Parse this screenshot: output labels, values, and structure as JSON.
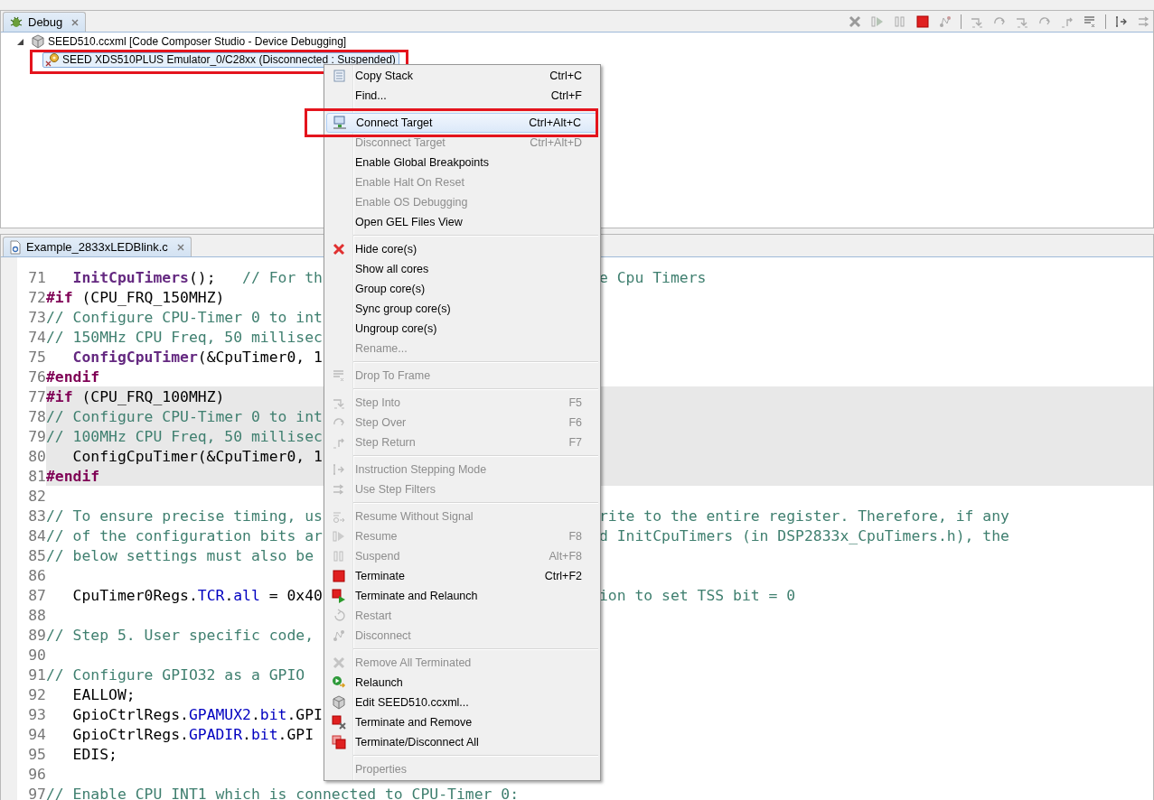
{
  "debug_view": {
    "tab": {
      "label": "Debug",
      "selected": true
    },
    "tree": [
      {
        "label": "SEED510.ccxml [Code Composer Studio - Device Debugging]",
        "expanded": true,
        "selected": false,
        "annotated": false,
        "children": [
          {
            "label": "SEED XDS510PLUS Emulator_0/C28xx (Disconnected : Suspended)",
            "selected": true,
            "annotated": true
          }
        ]
      }
    ]
  },
  "editor": {
    "tab": {
      "label": "Example_2833xLEDBlink.c",
      "selected": true
    },
    "lines": [
      {
        "number": "71",
        "highlighted": false,
        "parts": [
          {
            "kind": "function",
            "text": "   InitCpuTimers"
          },
          {
            "kind": "text",
            "text": "();   "
          },
          {
            "kind": "comment",
            "text": "// For th"
          }
        ],
        "right": [
          {
            "kind": "comment",
            "text": "e Cpu Timers"
          }
        ]
      },
      {
        "number": "72",
        "highlighted": false,
        "parts": [
          {
            "kind": "directive",
            "text": "#if"
          },
          {
            "kind": "text",
            "text": " (CPU_FRQ_150MHZ)"
          }
        ]
      },
      {
        "number": "73",
        "highlighted": false,
        "parts": [
          {
            "kind": "comment",
            "text": "// Configure CPU-Timer 0 to int"
          }
        ]
      },
      {
        "number": "74",
        "highlighted": false,
        "parts": [
          {
            "kind": "comment",
            "text": "// 150MHz CPU Freq, 50 millisec"
          }
        ]
      },
      {
        "number": "75",
        "highlighted": false,
        "parts": [
          {
            "kind": "function",
            "text": "   ConfigCpuTimer"
          },
          {
            "kind": "text",
            "text": "(&CpuTimer0, 1"
          }
        ]
      },
      {
        "number": "76",
        "highlighted": false,
        "parts": [
          {
            "kind": "directive",
            "text": "#endif"
          }
        ]
      },
      {
        "number": "77",
        "highlighted": true,
        "parts": [
          {
            "kind": "directive",
            "text": "#if"
          },
          {
            "kind": "text",
            "text": " (CPU_FRQ_100MHZ)"
          }
        ]
      },
      {
        "number": "78",
        "highlighted": true,
        "parts": [
          {
            "kind": "comment",
            "text": "// Configure CPU-Timer 0 to int"
          }
        ]
      },
      {
        "number": "79",
        "highlighted": true,
        "parts": [
          {
            "kind": "comment",
            "text": "// 100MHz CPU Freq, 50 millisec"
          }
        ]
      },
      {
        "number": "80",
        "highlighted": true,
        "parts": [
          {
            "kind": "text",
            "text": "   ConfigCpuTimer(&CpuTimer0, 1"
          }
        ]
      },
      {
        "number": "81",
        "highlighted": true,
        "parts": [
          {
            "kind": "directive",
            "text": "#endif"
          }
        ]
      },
      {
        "number": "82",
        "highlighted": false
      },
      {
        "number": "83",
        "highlighted": false,
        "parts": [
          {
            "kind": "comment",
            "text": "// To ensure precise timing, us"
          }
        ],
        "right": [
          {
            "kind": "comment",
            "text": "rite to the entire register. Therefore, if any"
          }
        ]
      },
      {
        "number": "84",
        "highlighted": false,
        "parts": [
          {
            "kind": "comment",
            "text": "// of the configuration bits ar"
          }
        ],
        "right": [
          {
            "kind": "comment",
            "text": "d InitCpuTimers (in DSP2833x_CpuTimers.h), the"
          }
        ]
      },
      {
        "number": "85",
        "highlighted": false,
        "parts": [
          {
            "kind": "comment",
            "text": "// below settings must also be"
          }
        ]
      },
      {
        "number": "86",
        "highlighted": false
      },
      {
        "number": "87",
        "highlighted": false,
        "parts": [
          {
            "kind": "text",
            "text": "   CpuTimer0Regs."
          },
          {
            "kind": "field",
            "text": "TCR"
          },
          {
            "kind": "text",
            "text": "."
          },
          {
            "kind": "field",
            "text": "all"
          },
          {
            "kind": "text",
            "text": " = 0x40"
          }
        ],
        "right": [
          {
            "kind": "comment",
            "text": "ion to set TSS bit = 0"
          }
        ]
      },
      {
        "number": "88",
        "highlighted": false
      },
      {
        "number": "89",
        "highlighted": false,
        "parts": [
          {
            "kind": "comment",
            "text": "// Step 5. User specific code,"
          }
        ]
      },
      {
        "number": "90",
        "highlighted": false
      },
      {
        "number": "91",
        "highlighted": false,
        "parts": [
          {
            "kind": "comment",
            "text": "// Configure GPIO32 as a GPIO"
          }
        ]
      },
      {
        "number": "92",
        "highlighted": false,
        "parts": [
          {
            "kind": "text",
            "text": "   EALLOW;"
          }
        ]
      },
      {
        "number": "93",
        "highlighted": false,
        "parts": [
          {
            "kind": "text",
            "text": "   GpioCtrlRegs."
          },
          {
            "kind": "field",
            "text": "GPAMUX2"
          },
          {
            "kind": "text",
            "text": "."
          },
          {
            "kind": "field",
            "text": "bit"
          },
          {
            "kind": "text",
            "text": ".GPI"
          }
        ]
      },
      {
        "number": "94",
        "highlighted": false,
        "parts": [
          {
            "kind": "text",
            "text": "   GpioCtrlRegs."
          },
          {
            "kind": "field",
            "text": "GPADIR"
          },
          {
            "kind": "text",
            "text": "."
          },
          {
            "kind": "field",
            "text": "bit"
          },
          {
            "kind": "text",
            "text": ".GPI"
          }
        ]
      },
      {
        "number": "95",
        "highlighted": false,
        "parts": [
          {
            "kind": "text",
            "text": "   EDIS;"
          }
        ]
      },
      {
        "number": "96",
        "highlighted": false
      },
      {
        "number": "97",
        "highlighted": false,
        "parts": [
          {
            "kind": "comment",
            "text": "// Enable CPU INT1 which is connected to CPU-Timer 0:"
          }
        ]
      }
    ]
  },
  "context_menu": {
    "groups": [
      [
        {
          "label": "Copy Stack",
          "shortcut": "Ctrl+C",
          "disabled": false,
          "selected": false,
          "annotated": false
        },
        {
          "label": "Find...",
          "shortcut": "Ctrl+F",
          "disabled": false,
          "selected": false,
          "annotated": false
        }
      ],
      [
        {
          "label": "Connect Target",
          "shortcut": "Ctrl+Alt+C",
          "disabled": false,
          "selected": true,
          "annotated": true
        },
        {
          "label": "Disconnect Target",
          "shortcut": "Ctrl+Alt+D",
          "disabled": true,
          "selected": false,
          "annotated": false
        },
        {
          "label": "Enable Global Breakpoints",
          "disabled": false,
          "selected": false,
          "annotated": false
        },
        {
          "label": "Enable Halt On Reset",
          "disabled": true,
          "selected": false,
          "annotated": false
        },
        {
          "label": "Enable OS Debugging",
          "disabled": true,
          "selected": false,
          "annotated": false
        },
        {
          "label": "Open GEL Files View",
          "disabled": false,
          "selected": false,
          "annotated": false
        }
      ],
      [
        {
          "label": "Hide core(s)",
          "disabled": false,
          "selected": false,
          "annotated": false
        },
        {
          "label": "Show all cores",
          "disabled": false,
          "selected": false,
          "annotated": false
        },
        {
          "label": "Group core(s)",
          "disabled": false,
          "selected": false,
          "annotated": false
        },
        {
          "label": "Sync group core(s)",
          "disabled": false,
          "selected": false,
          "annotated": false
        },
        {
          "label": "Ungroup core(s)",
          "disabled": false,
          "selected": false,
          "annotated": false
        },
        {
          "label": "Rename...",
          "disabled": true,
          "selected": false,
          "annotated": false
        }
      ],
      [
        {
          "label": "Drop To Frame",
          "disabled": true,
          "selected": false,
          "annotated": false
        }
      ],
      [
        {
          "label": "Step Into",
          "shortcut": "F5",
          "disabled": true,
          "selected": false,
          "annotated": false
        },
        {
          "label": "Step Over",
          "shortcut": "F6",
          "disabled": true,
          "selected": false,
          "annotated": false
        },
        {
          "label": "Step Return",
          "shortcut": "F7",
          "disabled": true,
          "selected": false,
          "annotated": false
        }
      ],
      [
        {
          "label": "Instruction Stepping Mode",
          "disabled": true,
          "selected": false,
          "annotated": false
        },
        {
          "label": "Use Step Filters",
          "disabled": true,
          "selected": false,
          "annotated": false
        }
      ],
      [
        {
          "label": "Resume Without Signal",
          "disabled": true,
          "selected": false,
          "annotated": false
        },
        {
          "label": "Resume",
          "shortcut": "F8",
          "disabled": true,
          "selected": false,
          "annotated": false
        },
        {
          "label": "Suspend",
          "shortcut": "Alt+F8",
          "disabled": true,
          "selected": false,
          "annotated": false
        },
        {
          "label": "Terminate",
          "shortcut": "Ctrl+F2",
          "disabled": false,
          "selected": false,
          "annotated": false
        },
        {
          "label": "Terminate and Relaunch",
          "disabled": false,
          "selected": false,
          "annotated": false
        },
        {
          "label": "Restart",
          "disabled": true,
          "selected": false,
          "annotated": false
        },
        {
          "label": "Disconnect",
          "disabled": true,
          "selected": false,
          "annotated": false
        }
      ],
      [
        {
          "label": "Remove All Terminated",
          "disabled": true,
          "selected": false,
          "annotated": false
        },
        {
          "label": "Relaunch",
          "disabled": false,
          "selected": false,
          "annotated": false
        },
        {
          "label": "Edit SEED510.ccxml...",
          "disabled": false,
          "selected": false,
          "annotated": false
        },
        {
          "label": "Terminate and Remove",
          "disabled": false,
          "selected": false,
          "annotated": false
        },
        {
          "label": "Terminate/Disconnect All",
          "disabled": false,
          "selected": false,
          "annotated": false
        }
      ],
      [
        {
          "label": "Properties",
          "disabled": true,
          "selected": false,
          "annotated": false
        }
      ]
    ]
  }
}
